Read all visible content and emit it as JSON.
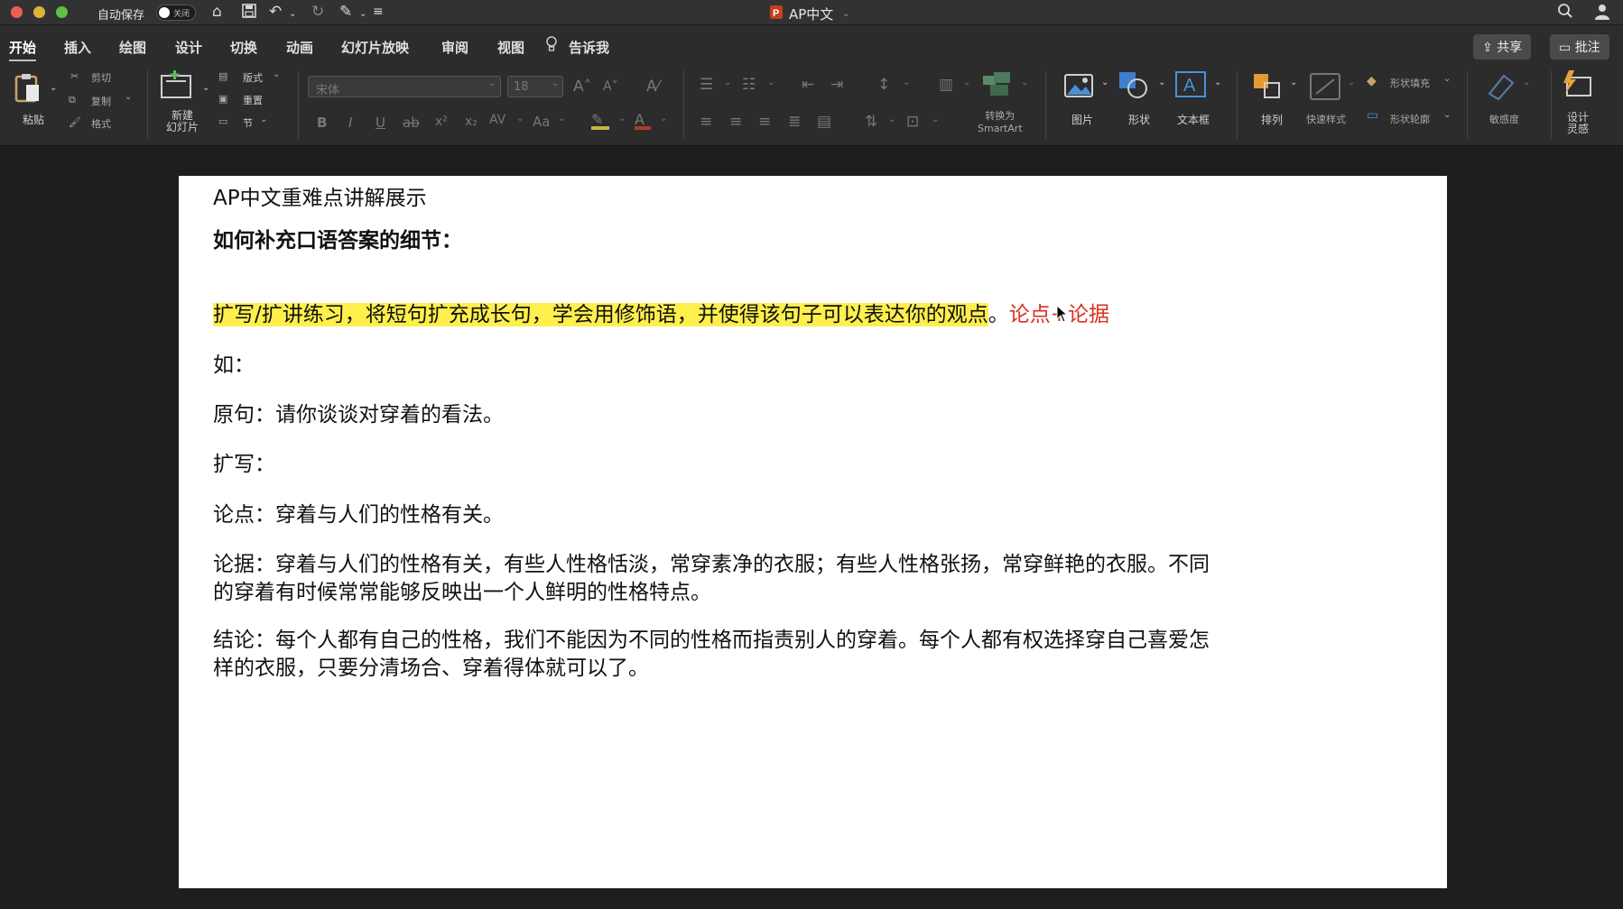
{
  "window": {
    "title": "AP中文",
    "autosave_label": "自动保存",
    "autosave_state": "关闭"
  },
  "tabs": [
    {
      "label": "开始",
      "active": true
    },
    {
      "label": "插入"
    },
    {
      "label": "绘图"
    },
    {
      "label": "设计"
    },
    {
      "label": "切换"
    },
    {
      "label": "动画"
    },
    {
      "label": "幻灯片放映"
    },
    {
      "label": "审阅"
    },
    {
      "label": "视图"
    },
    {
      "label": "告诉我"
    }
  ],
  "tab_actions": {
    "share": "共享",
    "comments": "批注"
  },
  "ribbon": {
    "paste": "粘贴",
    "cut": "剪切",
    "copy": "复制",
    "format": "格式",
    "new_slide": "新建\n幻灯片",
    "layout": "版式",
    "reset": "重置",
    "section": "节",
    "font_name": "宋体",
    "font_size": "18",
    "smartart": "转换为\nSmartArt",
    "picture": "图片",
    "shape": "形状",
    "textbox": "文本框",
    "arrange": "排列",
    "quick_styles": "快速样式",
    "shape_fill": "形状填充",
    "shape_outline": "形状轮廓",
    "sensitivity": "敏感度",
    "designer": "设计\n灵感"
  },
  "slide": {
    "title": "AP中文重难点讲解展示",
    "subtitle": "如何补充口语答案的细节：",
    "highlight_text": "扩写/扩讲练习，将短句扩充成长句，学会用修饰语，并使得该句子可以表达你的观点",
    "highlight_tail": "。",
    "red_note": "论点+论据",
    "lines": [
      "如：",
      "原句：请你谈谈对穿着的看法。",
      "扩写：",
      "论点：穿着与人们的性格有关。",
      "论据：穿着与人们的性格有关，有些人性格恬淡，常穿素净的衣服；有些人性格张扬，常穿鲜艳的衣服。不同",
      "的穿着有时候常常能够反映出一个人鲜明的性格特点。",
      "结论：每个人都有自己的性格，我们不能因为不同的性格而指责别人的穿着。每个人都有权选择穿自己喜爱怎",
      "样的衣服，只要分清场合、穿着得体就可以了。"
    ]
  },
  "colors": {
    "highlight": "#ffef4d",
    "note_red": "#d7301f",
    "close": "#ec5f57",
    "minimize": "#e0b23a",
    "maximize": "#5fbf47"
  }
}
